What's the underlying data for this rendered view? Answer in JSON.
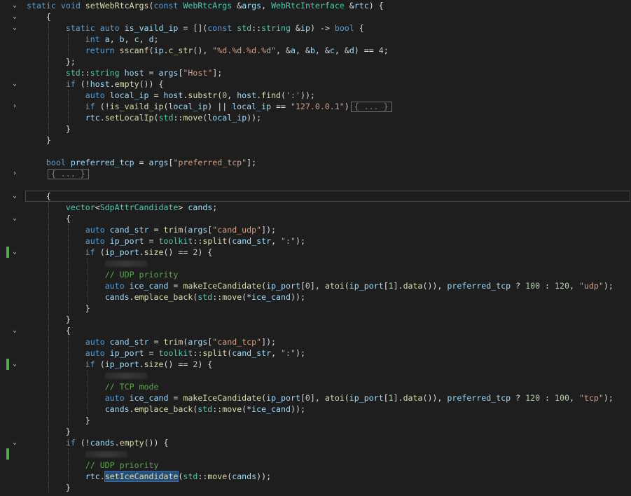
{
  "collapsed_label": "{ ... }",
  "lines": [
    {
      "code": "static void setWebRtcArgs(const WebRtcArgs &args, WebRtcInterface &rtc) {",
      "fold": "open",
      "changed": false
    },
    {
      "code": "    {",
      "fold": "open",
      "changed": false
    },
    {
      "code": "        static auto is_vaild_ip = [](const std::string &ip) -> bool {",
      "fold": "open",
      "changed": false
    },
    {
      "code": "            int a, b, c, d;",
      "fold": "",
      "changed": false
    },
    {
      "code": "            return sscanf(ip.c_str(), \"%d.%d.%d.%d\", &a, &b, &c, &d) == 4;",
      "fold": "",
      "changed": false
    },
    {
      "code": "        };",
      "fold": "",
      "changed": false
    },
    {
      "code": "        std::string host = args[\"Host\"];",
      "fold": "",
      "changed": false
    },
    {
      "code": "        if (!host.empty()) {",
      "fold": "open",
      "changed": false
    },
    {
      "code": "            auto local_ip = host.substr(0, host.find(':'));",
      "fold": "",
      "changed": false
    },
    {
      "code": "            if (!is_vaild_ip(local_ip) || local_ip == \"127.0.0.1\")",
      "fold": "closed",
      "changed": false,
      "collapsed": true
    },
    {
      "code": "            rtc.setLocalIp(std::move(local_ip));",
      "fold": "",
      "changed": false
    },
    {
      "code": "        }",
      "fold": "",
      "changed": false
    },
    {
      "code": "    }",
      "fold": "",
      "changed": false
    },
    {
      "code": "",
      "fold": "",
      "changed": false
    },
    {
      "code": "    bool preferred_tcp = args[\"preferred_tcp\"];",
      "fold": "",
      "changed": false
    },
    {
      "code": "    ",
      "fold": "closed",
      "changed": false,
      "collapsed": true
    },
    {
      "code": "",
      "fold": "",
      "changed": false
    },
    {
      "code": "    {",
      "fold": "open",
      "changed": false,
      "caret": true
    },
    {
      "code": "        vector<SdpAttrCandidate> cands;",
      "fold": "",
      "changed": false
    },
    {
      "code": "        {",
      "fold": "open",
      "changed": false
    },
    {
      "code": "            auto cand_str = trim(args[\"cand_udp\"]);",
      "fold": "",
      "changed": false
    },
    {
      "code": "            auto ip_port = toolkit::split(cand_str, \":\");",
      "fold": "",
      "changed": false
    },
    {
      "code": "            if (ip_port.size() == 2) {",
      "fold": "open",
      "changed": true
    },
    {
      "code": "                ",
      "fold": "",
      "changed": false,
      "blur": true
    },
    {
      "code": "                // UDP priority",
      "fold": "",
      "changed": false
    },
    {
      "code": "                auto ice_cand = makeIceCandidate(ip_port[0], atoi(ip_port[1].data()), preferred_tcp ? 100 : 120, \"udp\");",
      "fold": "",
      "changed": false
    },
    {
      "code": "                cands.emplace_back(std::move(*ice_cand));",
      "fold": "",
      "changed": false
    },
    {
      "code": "            }",
      "fold": "",
      "changed": false
    },
    {
      "code": "        }",
      "fold": "",
      "changed": false
    },
    {
      "code": "        {",
      "fold": "open",
      "changed": false
    },
    {
      "code": "            auto cand_str = trim(args[\"cand_tcp\"]);",
      "fold": "",
      "changed": false
    },
    {
      "code": "            auto ip_port = toolkit::split(cand_str, \":\");",
      "fold": "",
      "changed": false
    },
    {
      "code": "            if (ip_port.size() == 2) {",
      "fold": "open",
      "changed": true
    },
    {
      "code": "                ",
      "fold": "",
      "changed": false,
      "blur": true
    },
    {
      "code": "                // TCP mode",
      "fold": "",
      "changed": false
    },
    {
      "code": "                auto ice_cand = makeIceCandidate(ip_port[0], atoi(ip_port[1].data()), preferred_tcp ? 120 : 100, \"tcp\");",
      "fold": "",
      "changed": false
    },
    {
      "code": "                cands.emplace_back(std::move(*ice_cand));",
      "fold": "",
      "changed": false
    },
    {
      "code": "            }",
      "fold": "",
      "changed": false
    },
    {
      "code": "        }",
      "fold": "",
      "changed": false
    },
    {
      "code": "        if (!cands.empty()) {",
      "fold": "open",
      "changed": false
    },
    {
      "code": "            ",
      "fold": "",
      "changed": true,
      "blur": true
    },
    {
      "code": "            // UDP priority",
      "fold": "",
      "changed": false
    },
    {
      "code": "            rtc.setIceCandidate(std::move(cands));",
      "fold": "",
      "changed": false,
      "selected": "setIceCandidate"
    },
    {
      "code": "        }",
      "fold": "",
      "changed": false
    }
  ]
}
